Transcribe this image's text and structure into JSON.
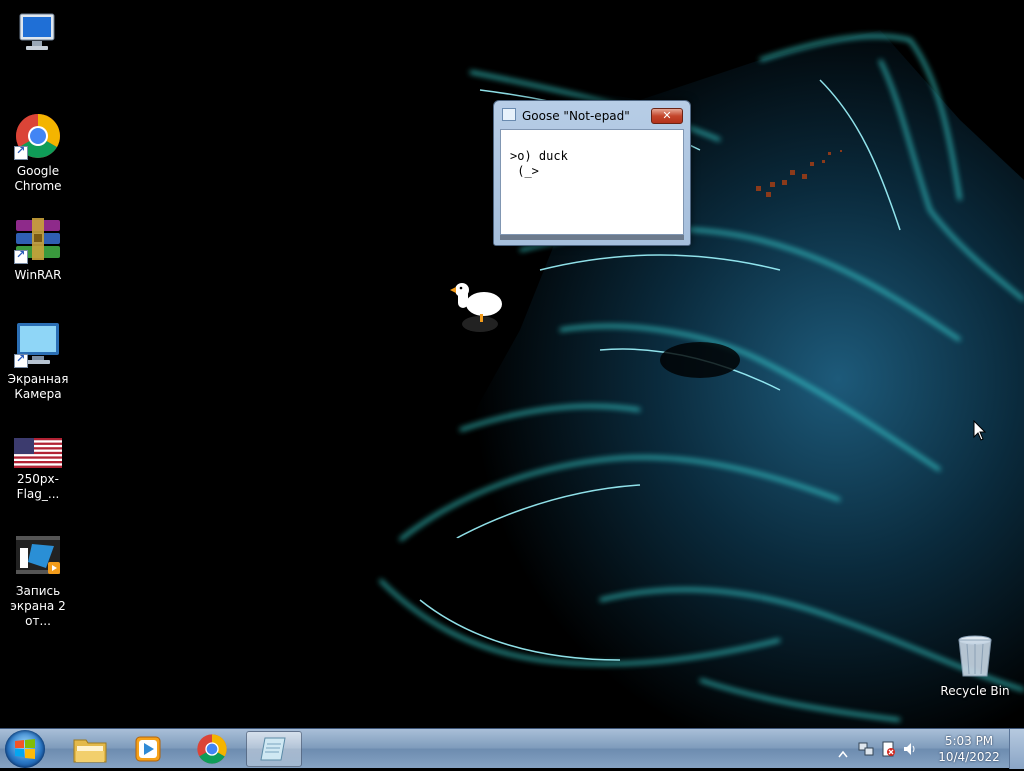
{
  "desktop": {
    "icons": [
      {
        "label": "",
        "icon": "computer-icon"
      },
      {
        "label": "Google Chrome",
        "icon": "chrome-icon"
      },
      {
        "label": "WinRAR",
        "icon": "winrar-icon"
      },
      {
        "label": "Экранная Камера",
        "icon": "screen-camera-icon"
      },
      {
        "label": "250px-Flag_...",
        "icon": "us-flag-icon"
      },
      {
        "label": "Запись экрана 2 от...",
        "icon": "video-file-icon"
      },
      {
        "label": "Recycle Bin",
        "icon": "recycle-bin-icon"
      }
    ],
    "wallpaper": "neon-wolf-wallpaper"
  },
  "notepad": {
    "title": "Goose \"Not-epad\"",
    "close_label": "✕",
    "text": ">o) duck\n (_>"
  },
  "taskbar": {
    "start": "start-button",
    "pinned": [
      "file-explorer-icon",
      "media-player-icon",
      "chrome-icon",
      "notepad-icon"
    ],
    "clock_time": "5:03 PM",
    "clock_date": "10/4/2022"
  },
  "colors": {
    "wallpaper_glow": "#39e6e6",
    "taskbar": "#7f9cbc",
    "close_red": "#c4452b"
  }
}
